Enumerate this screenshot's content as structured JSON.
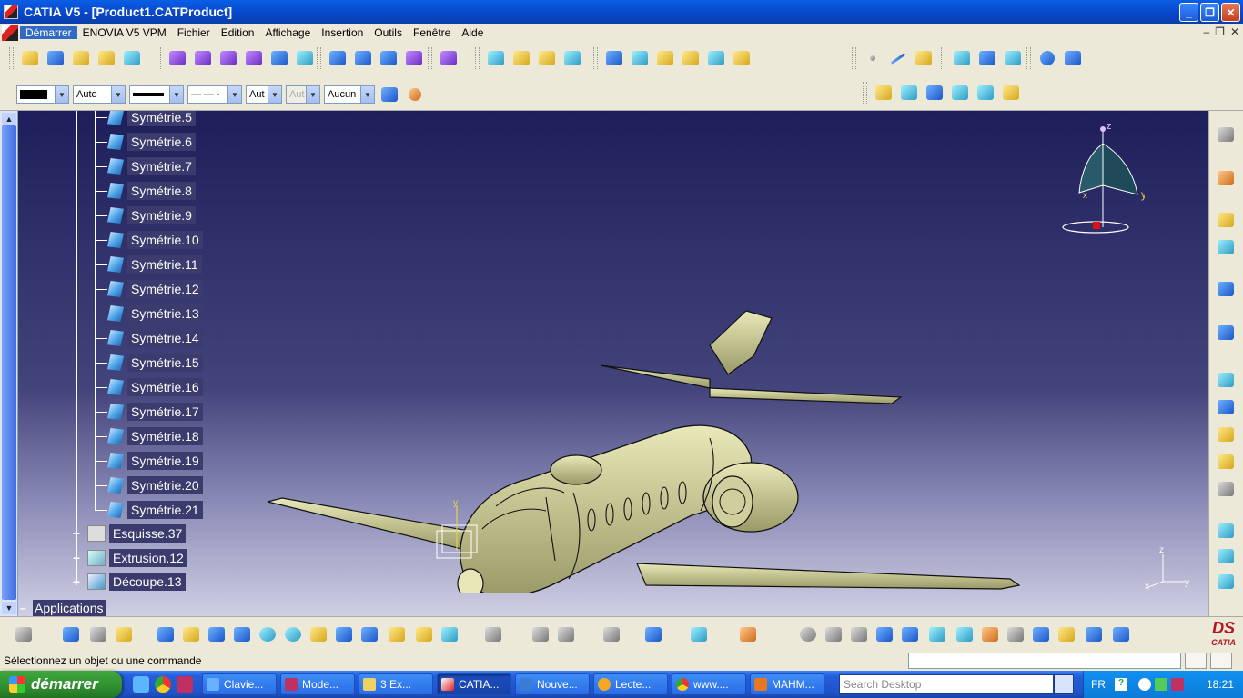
{
  "window": {
    "title": "CATIA V5 - [Product1.CATProduct]"
  },
  "menu": {
    "items": [
      "Démarrer",
      "ENOVIA V5 VPM",
      "Fichier",
      "Edition",
      "Affichage",
      "Insertion",
      "Outils",
      "Fenêtre",
      "Aide"
    ]
  },
  "properties_toolbar": {
    "color_value": "",
    "transparency_value": "Auto",
    "linetype_value": "— — ·",
    "lineweight_short": "Aut",
    "point_short": "Aut",
    "layer_value": "Aucun"
  },
  "tree": {
    "items": [
      "Symétrie.5",
      "Symétrie.6",
      "Symétrie.7",
      "Symétrie.8",
      "Symétrie.9",
      "Symétrie.10",
      "Symétrie.11",
      "Symétrie.12",
      "Symétrie.13",
      "Symétrie.14",
      "Symétrie.15",
      "Symétrie.16",
      "Symétrie.17",
      "Symétrie.18",
      "Symétrie.19",
      "Symétrie.20",
      "Symétrie.21"
    ],
    "features": [
      "Esquisse.37",
      "Extrusion.12",
      "Découpe.13"
    ],
    "applications": "Applications"
  },
  "compass": {
    "z": "z",
    "y": "y",
    "x": "x"
  },
  "axes": {
    "z": "z",
    "x": "x",
    "y": "y"
  },
  "status": {
    "message": "Sélectionnez un objet ou une commande"
  },
  "brand": {
    "logo_text": "CATIA"
  },
  "taskbar": {
    "start": "démarrer",
    "tasks": [
      "Clavie...",
      "Mode...",
      "3 Ex...",
      "CATIA...",
      "Nouve...",
      "Lecte...",
      "www....",
      "MAHM..."
    ],
    "search_placeholder": "Search Desktop",
    "lang": "FR",
    "clock": "18:21"
  },
  "colors": {
    "accent": "#316ac5",
    "viewport_top": "#1e1e5a",
    "aircraft": "#d8d8a0"
  }
}
